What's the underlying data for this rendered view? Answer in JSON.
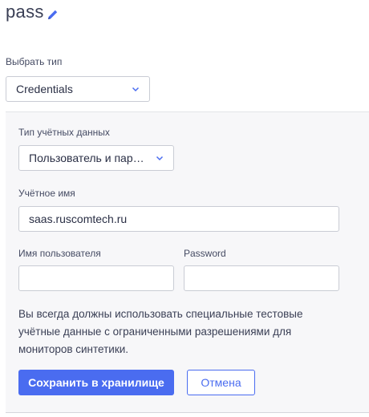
{
  "header": {
    "title": "pass",
    "edit_icon": "pencil-icon"
  },
  "type_select": {
    "label": "Выбрать тип",
    "value": "Credentials"
  },
  "credentials_panel": {
    "credential_type": {
      "label": "Тип учётных данных",
      "value": "Пользователь и пароль"
    },
    "credential_name": {
      "label": "Учётное имя",
      "value": "saas.ruscomtech.ru"
    },
    "username": {
      "label": "Имя пользователя",
      "value": ""
    },
    "password": {
      "label": "Password",
      "value": ""
    },
    "note": "Вы всегда должны использовать специальные тестовые учётные данные с ограниченными разрешениями для мониторов синтетики.",
    "save_label": "Сохранить в хранилище",
    "cancel_label": "Отмена"
  },
  "colors": {
    "accent": "#4a6cf0",
    "panel_bg": "#f7f7f9",
    "text": "#2a2f45"
  }
}
